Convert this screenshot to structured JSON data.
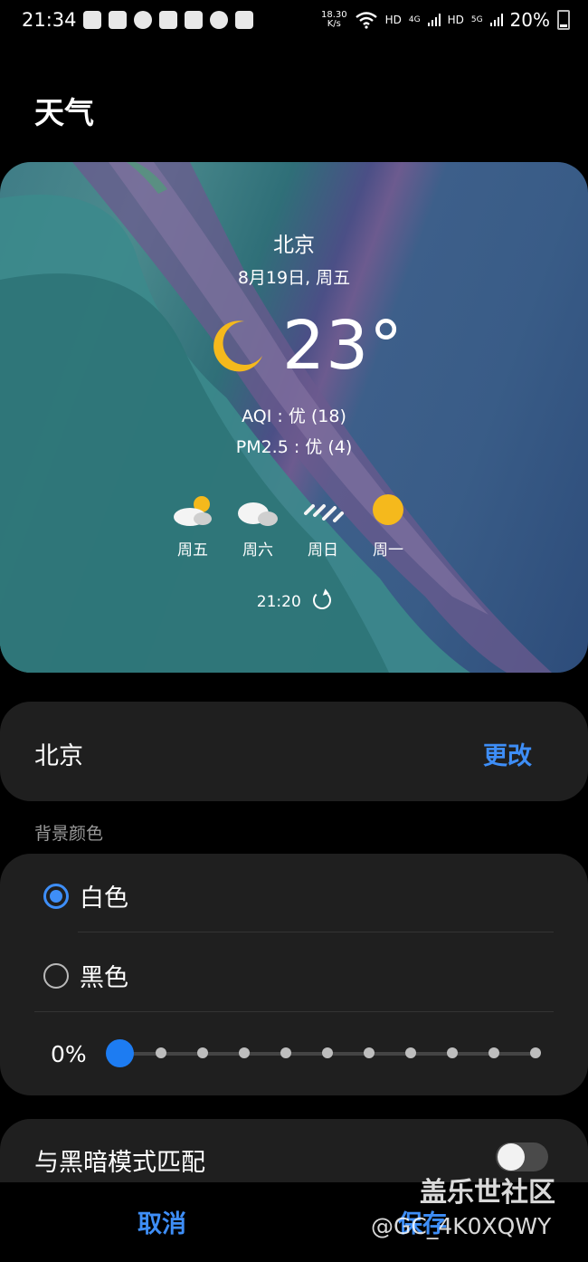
{
  "status_bar": {
    "time": "21:34",
    "net_speed_value": "18.30",
    "net_speed_unit": "K/s",
    "hd1": "HD",
    "lte": "4G",
    "hd2": "HD",
    "nr": "5G",
    "battery": "20%"
  },
  "page": {
    "title": "天气"
  },
  "widget": {
    "city": "北京",
    "date": "8月19日, 周五",
    "temperature": "23°",
    "aqi": "AQI : 优 (18)",
    "pm25": "PM2.5 : 优 (4)",
    "forecast": [
      {
        "day": "周五",
        "icon": "partly-cloudy-icon"
      },
      {
        "day": "周六",
        "icon": "cloudy-icon"
      },
      {
        "day": "周日",
        "icon": "rain-icon"
      },
      {
        "day": "周一",
        "icon": "sunny-icon"
      }
    ],
    "updated": "21:20",
    "accent_sun": "#f5b91c"
  },
  "location": {
    "city": "北京",
    "change_label": "更改"
  },
  "background": {
    "section_label": "背景颜色",
    "option_white": "白色",
    "option_black": "黑色",
    "selected": "白色",
    "transparency": "0%",
    "transparency_level": 0
  },
  "dark_mode": {
    "label": "与黑暗模式匹配",
    "enabled": false
  },
  "actions": {
    "cancel": "取消",
    "save": "保存"
  },
  "watermark": {
    "line1": "盖乐世社区",
    "line2": "@GC_4K0XQWY"
  },
  "colors": {
    "accent": "#3e8ef7",
    "slider": "#1d7cf2",
    "card": "#1f1f1f"
  }
}
